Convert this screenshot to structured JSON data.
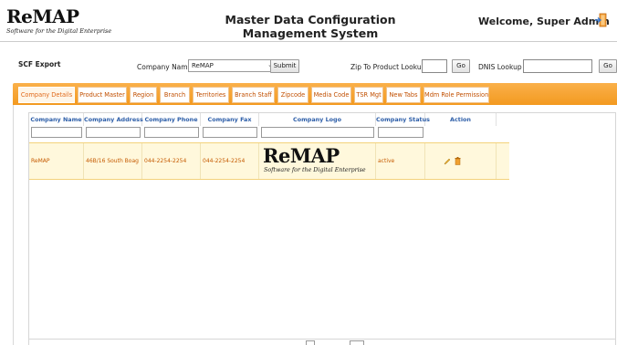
{
  "header": {
    "logo_main": "ReMAP",
    "logo_sub": "Software for the Digital Enterprise",
    "title": "Master Data Configuration Management System",
    "welcome": "Welcome, Super Admin",
    "logout_icon": "logout-door-icon"
  },
  "toolbar": {
    "scf_export": "SCF Export",
    "company_name_label": "Company Name",
    "company_name_value": "ReMAP",
    "submit_label": "Submit",
    "zip_lookup_label": "Zip To Product Lookup",
    "zip_value": "",
    "go_label": "Go",
    "dnis_label": "DNIS Lookup",
    "dnis_value": "",
    "go2_label": "Go"
  },
  "tabs": [
    {
      "label": "Company Details",
      "active": true
    },
    {
      "label": "Product Master"
    },
    {
      "label": "Region"
    },
    {
      "label": "Branch"
    },
    {
      "label": "Territories"
    },
    {
      "label": "Branch Staff"
    },
    {
      "label": "Zipcode"
    },
    {
      "label": "Media Code"
    },
    {
      "label": "TSR Mgt"
    },
    {
      "label": "New Tabs"
    },
    {
      "label": "Mdm Role Permission"
    }
  ],
  "grid": {
    "columns": [
      "Company Name",
      "Company Address",
      "Company Phone",
      "Company Fax",
      "Company Logo",
      "Company Status",
      "Action"
    ],
    "rows": [
      {
        "company_name": "ReMAP",
        "company_address": "46B/16 South Boag",
        "company_phone": "044-2254-2254",
        "company_fax": "044-2254-2254",
        "logo_main": "ReMAP",
        "logo_sub": "Software for the Digital Enterprise",
        "company_status": "active",
        "actions": [
          "edit-icon",
          "delete-icon"
        ]
      }
    ]
  },
  "colors": {
    "accent": "#f39a20",
    "tab_text": "#c14f00",
    "header_text": "#2d5ea8",
    "row_bg": "#fff8dc"
  }
}
